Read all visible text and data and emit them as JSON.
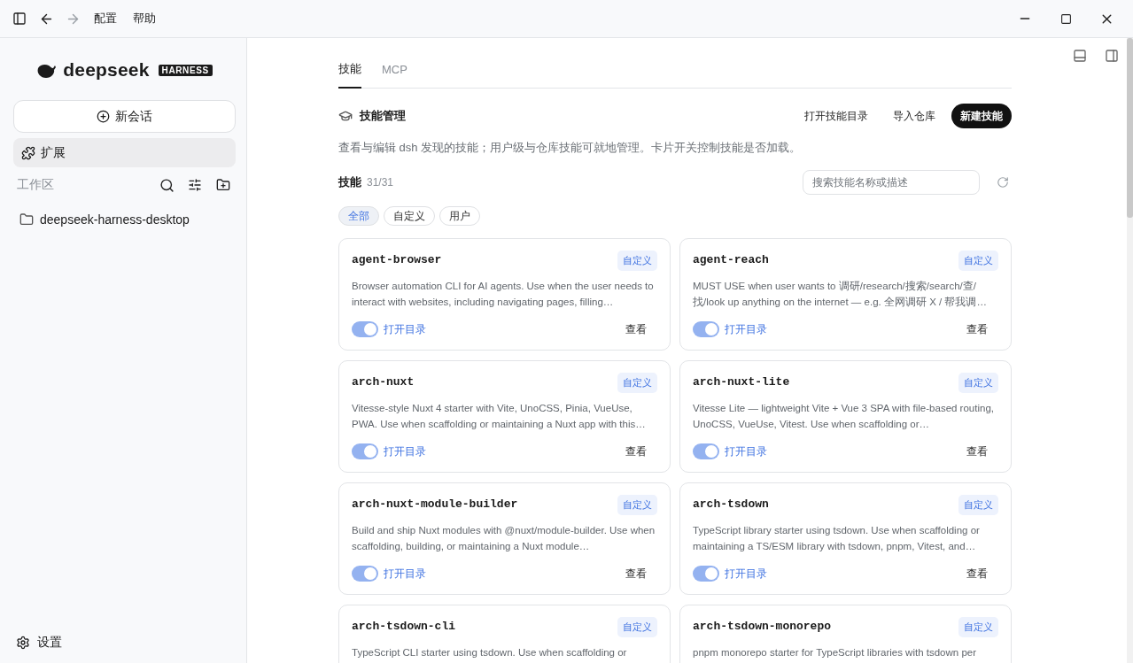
{
  "titlebar": {
    "menus": [
      "配置",
      "帮助"
    ]
  },
  "sidebar": {
    "logo": {
      "word": "deepseek",
      "badge": "HARNESS"
    },
    "new_chat": "新会话",
    "nav": [
      {
        "label": "扩展",
        "selected": true
      }
    ],
    "workspace_label": "工作区",
    "folders": [
      "deepseek-harness-desktop"
    ],
    "settings": "设置"
  },
  "tabs": [
    {
      "label": "技能",
      "selected": true
    },
    {
      "label": "MCP",
      "selected": false
    }
  ],
  "header": {
    "title": "技能管理",
    "actions": [
      {
        "label": "打开技能目录",
        "primary": false
      },
      {
        "label": "导入仓库",
        "primary": false
      },
      {
        "label": "新建技能",
        "primary": true
      }
    ],
    "description": "查看与编辑 dsh 发现的技能；用户级与仓库技能可就地管理。卡片开关控制技能是否加载。"
  },
  "skills_bar": {
    "title": "技能",
    "count": "31/31",
    "search": {
      "placeholder": "搜索技能名称或描述"
    }
  },
  "filters": [
    {
      "label": "全部",
      "selected": true
    },
    {
      "label": "自定义",
      "selected": false
    },
    {
      "label": "用户",
      "selected": false
    }
  ],
  "cards": [
    {
      "name": "agent-browser",
      "tag": "自定义",
      "description": "Browser automation CLI for AI agents. Use when the user needs to interact with websites, including navigating pages, filling…",
      "enabled": true,
      "toggle_label": "打开目录",
      "view": "查看"
    },
    {
      "name": "agent-reach",
      "tag": "自定义",
      "description": "MUST USE when user wants to 调研/research/搜索/search/查/找/look up anything on the internet — e.g. 全网调研 X / 帮我调…",
      "enabled": true,
      "toggle_label": "打开目录",
      "view": "查看"
    },
    {
      "name": "arch-nuxt",
      "tag": "自定义",
      "description": "Vitesse-style Nuxt 4 starter with Vite, UnoCSS, Pinia, VueUse, PWA. Use when scaffolding or maintaining a Nuxt app with this…",
      "enabled": true,
      "toggle_label": "打开目录",
      "view": "查看"
    },
    {
      "name": "arch-nuxt-lite",
      "tag": "自定义",
      "description": "Vitesse Lite — lightweight Vite + Vue 3 SPA with file-based routing, UnoCSS, VueUse, Vitest. Use when scaffolding or…",
      "enabled": true,
      "toggle_label": "打开目录",
      "view": "查看"
    },
    {
      "name": "arch-nuxt-module-builder",
      "tag": "自定义",
      "description": "Build and ship Nuxt modules with @nuxt/module-builder. Use when scaffolding, building, or maintaining a Nuxt module…",
      "enabled": true,
      "toggle_label": "打开目录",
      "view": "查看"
    },
    {
      "name": "arch-tsdown",
      "tag": "自定义",
      "description": "TypeScript library starter using tsdown. Use when scaffolding or maintaining a TS/ESM library with tsdown, pnpm, Vitest, and…",
      "enabled": true,
      "toggle_label": "打开目录",
      "view": "查看"
    },
    {
      "name": "arch-tsdown-cli",
      "tag": "自定义",
      "description": "TypeScript CLI starter using tsdown. Use when scaffolding or"
    },
    {
      "name": "arch-tsdown-monorepo",
      "tag": "自定义",
      "description": "pnpm monorepo starter for TypeScript libraries with tsdown per"
    }
  ]
}
